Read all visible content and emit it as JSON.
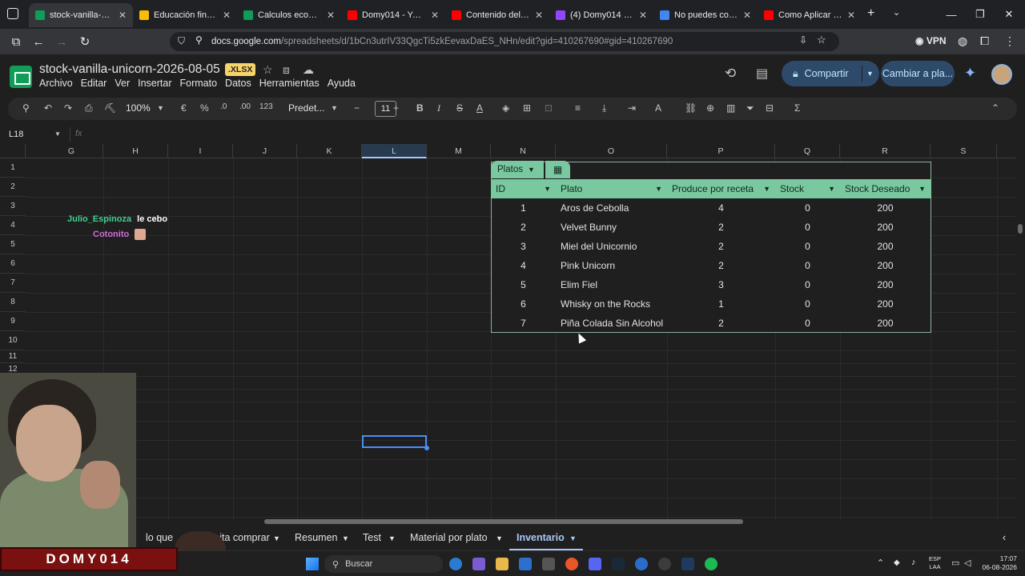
{
  "browser": {
    "tabs": [
      {
        "title": "stock-vanilla-unicorn",
        "color": "#0f9d58",
        "active": true
      },
      {
        "title": "Educación financiera",
        "color": "#fbbc04"
      },
      {
        "title": "Calculos economia -",
        "color": "#0f9d58"
      },
      {
        "title": "Domy014 - YouTube",
        "color": "#ff0000"
      },
      {
        "title": "Contenido del canal",
        "color": "#ff0000"
      },
      {
        "title": "(4) Domy014 - Prod",
        "color": "#9146ff"
      },
      {
        "title": "No puedes convertir",
        "color": "#4285f4"
      },
      {
        "title": "Como Aplicar Los C",
        "color": "#ff0000"
      }
    ],
    "url_host": "docs.google.com",
    "url_path": "/spreadsheets/d/1bCn3utrIV33QgcTi5zkEevaxDaES_NHn/edit?gid=410267690#gid=410267690",
    "vpn": "VPN"
  },
  "sheets": {
    "title": "stock-vanilla-unicorn-2026-08-05",
    "badge": ".XLSX",
    "menus": [
      "Archivo",
      "Editar",
      "Ver",
      "Insertar",
      "Formato",
      "Datos",
      "Herramientas",
      "Ayuda"
    ],
    "share_label": "Compartir",
    "switch_label": "Cambiar a pla...",
    "toolbar": {
      "zoom": "100%",
      "currency": "€",
      "percent": "%",
      "dec_minus": ".0",
      "dec_plus": ".00",
      "numfmt": "123",
      "font": "Predet...",
      "font_size": "11"
    },
    "name_box": "L18",
    "fx": "fx",
    "columns": [
      "G",
      "H",
      "I",
      "J",
      "K",
      "L",
      "M",
      "N",
      "O",
      "P",
      "Q",
      "R",
      "S"
    ],
    "rows": [
      "1",
      "2",
      "3",
      "4",
      "5",
      "6",
      "7",
      "8",
      "9",
      "10",
      "11",
      "12",
      "13"
    ],
    "selected_column": "L"
  },
  "table": {
    "name": "Platos",
    "headers": [
      "ID",
      "Plato",
      "Produce por receta",
      "Stock",
      "Stock Deseado"
    ],
    "rows": [
      [
        "1",
        "Aros de Cebolla",
        "4",
        "0",
        "200"
      ],
      [
        "2",
        "Velvet Bunny",
        "2",
        "0",
        "200"
      ],
      [
        "3",
        "Miel del Unicornio",
        "2",
        "0",
        "200"
      ],
      [
        "4",
        "Pink Unicorn",
        "2",
        "0",
        "200"
      ],
      [
        "5",
        "Elim Fiel",
        "3",
        "0",
        "200"
      ],
      [
        "6",
        "Whisky on the Rocks",
        "1",
        "0",
        "200"
      ],
      [
        "7",
        "Piña Colada Sin Alcohol",
        "2",
        "0",
        "200"
      ]
    ]
  },
  "chat": {
    "user1": "Julio_Espinoza",
    "msg1": "le cebo",
    "user2": "Cotonito"
  },
  "sheet_tabs": [
    "lo que",
    "sita comprar",
    "Resumen",
    "Test",
    "Material por plato",
    "Inventario"
  ],
  "active_sheet": "Inventario",
  "stream": {
    "banner": "DOMY014"
  },
  "taskbar": {
    "search": "Buscar",
    "lang1": "ESP",
    "lang2": "LAA",
    "time": "17:07",
    "date": "06-08-2026"
  }
}
